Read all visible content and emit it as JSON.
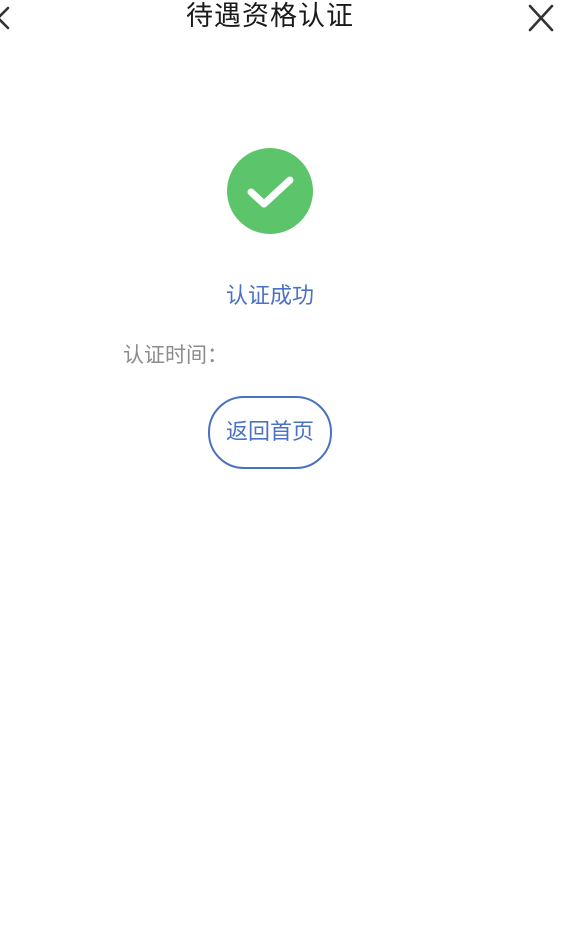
{
  "header": {
    "title": "待遇资格认证",
    "back_icon": "chevron-left-icon",
    "close_icon": "close-icon"
  },
  "result": {
    "status_icon": "check-circle-icon",
    "status_color": "#5cc46a",
    "message": "认证成功",
    "message_color": "#4a72c4",
    "time_label": "认证时间：",
    "time_value": ""
  },
  "actions": {
    "home_label": "返回首页"
  }
}
